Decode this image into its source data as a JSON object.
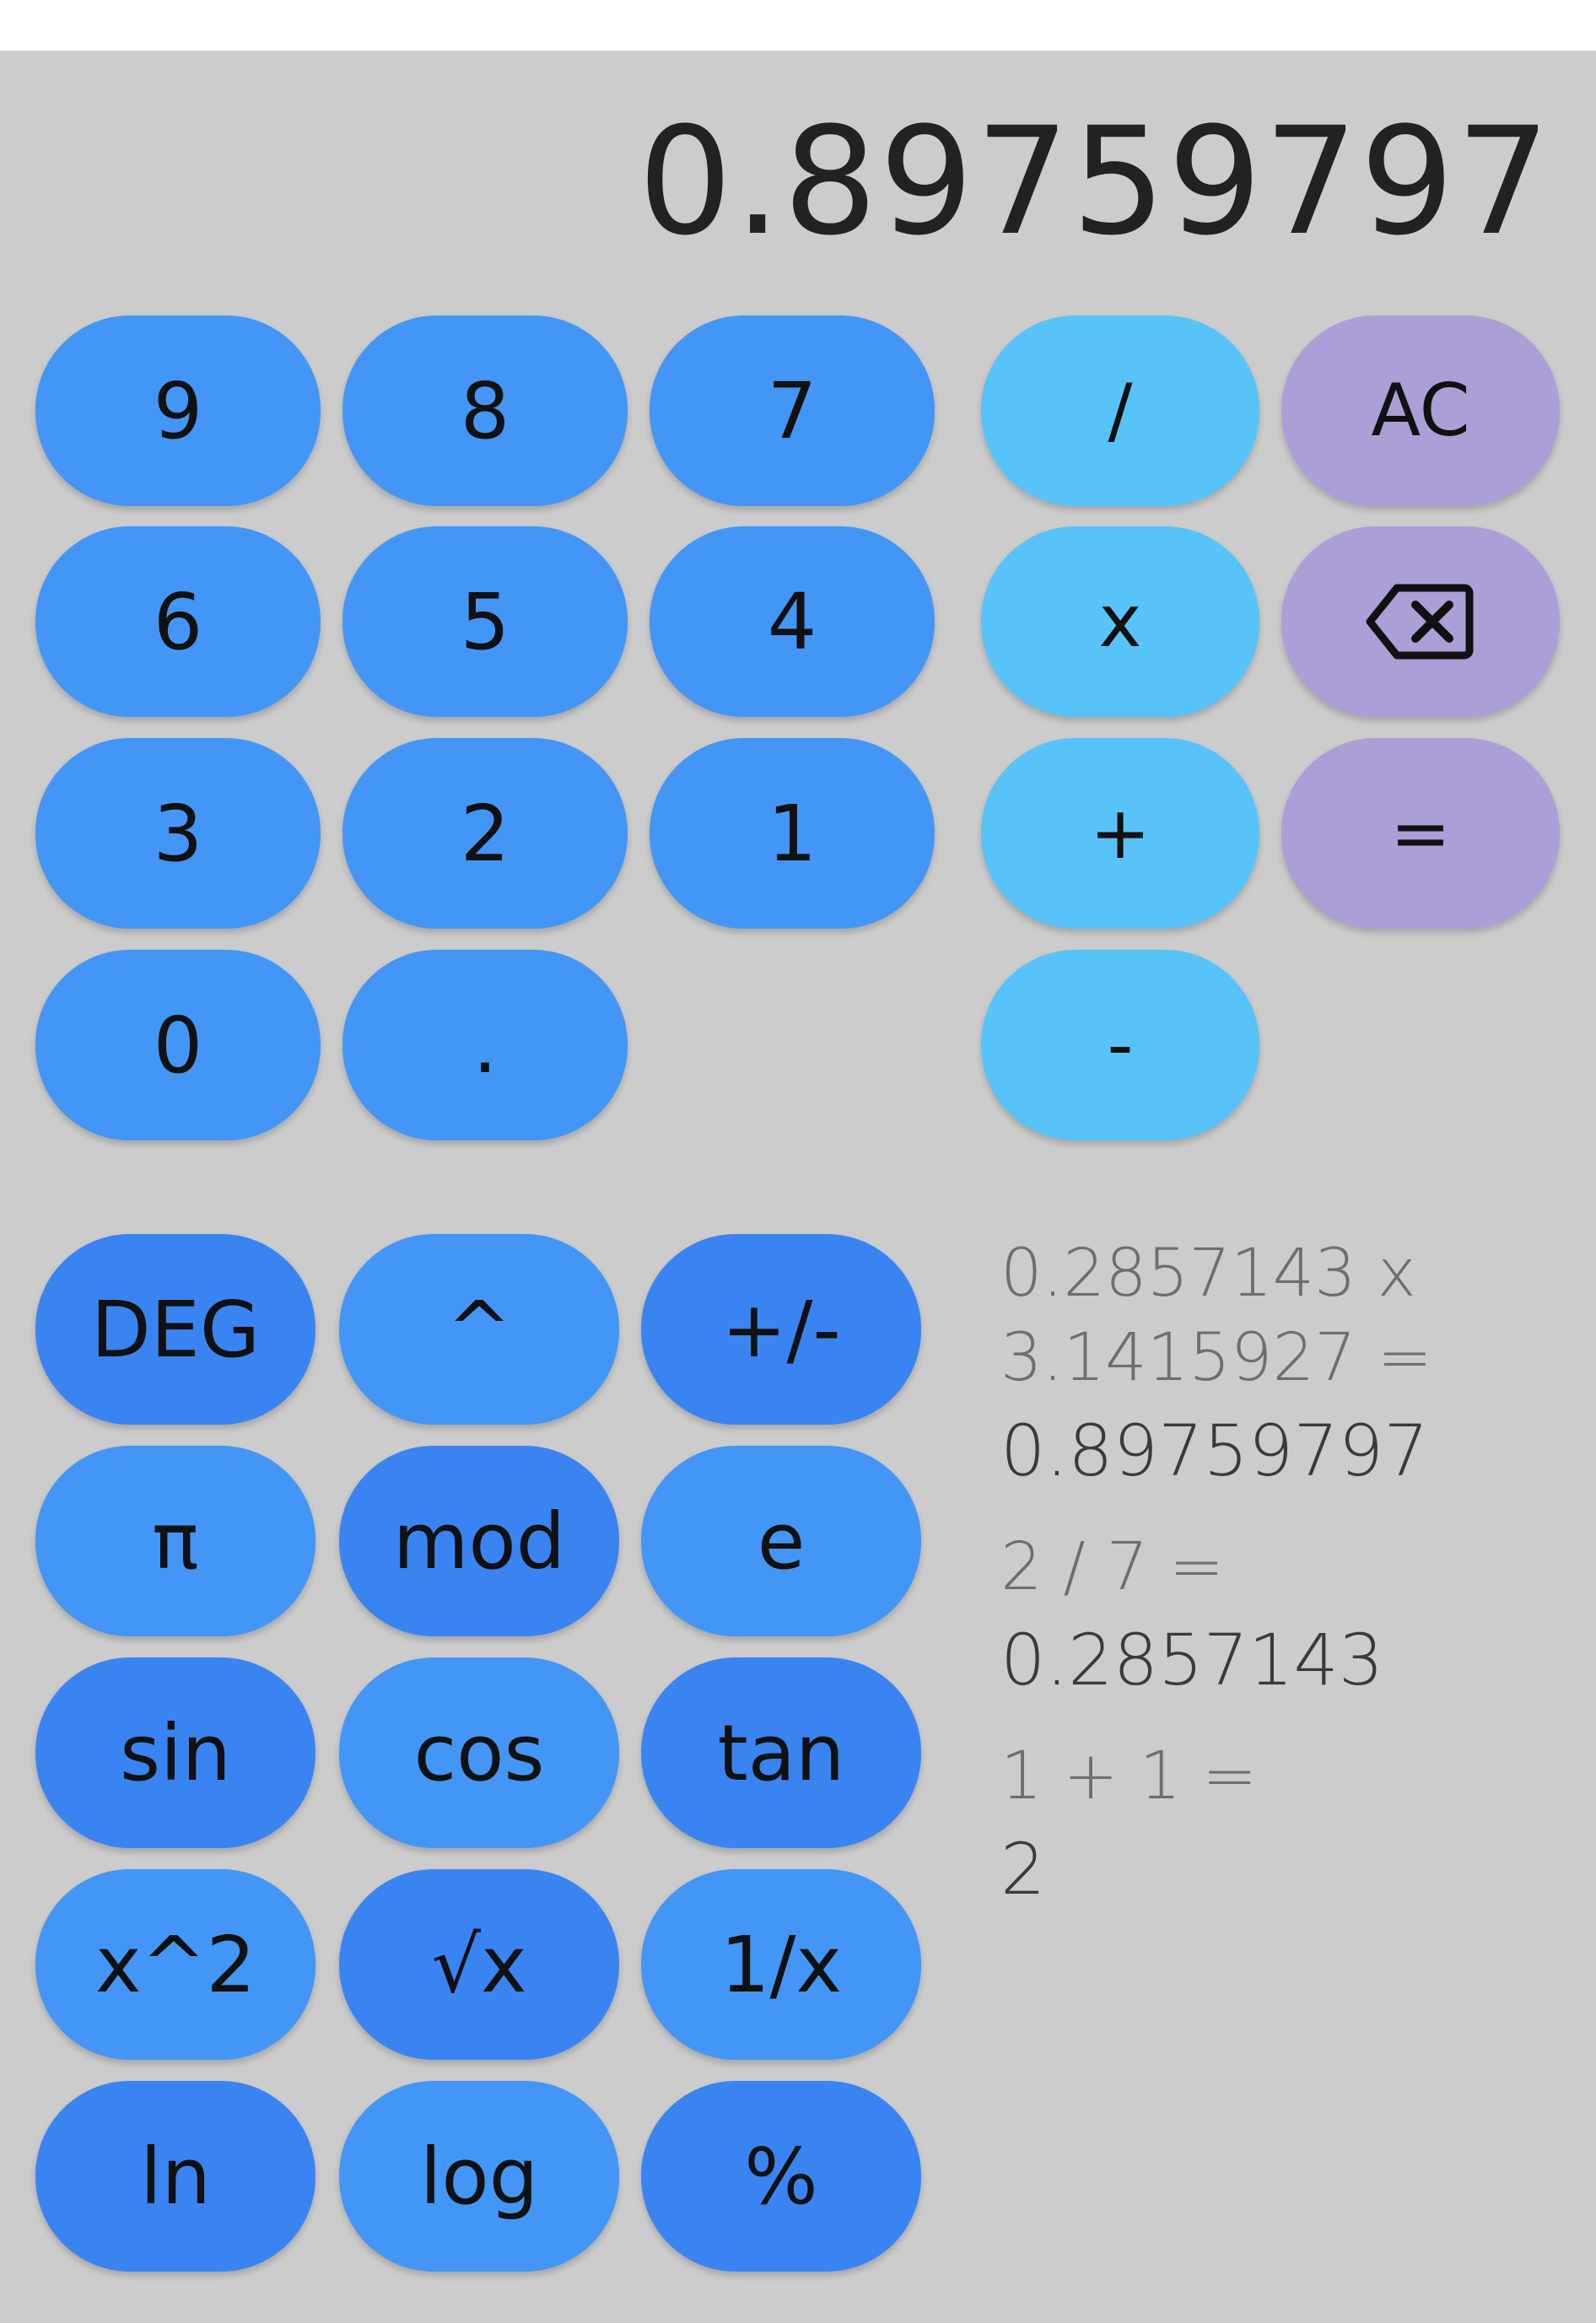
{
  "display": {
    "value": "0.89759797"
  },
  "keypad": {
    "digits": {
      "nine": "9",
      "eight": "8",
      "seven": "7",
      "six": "6",
      "five": "5",
      "four": "4",
      "three": "3",
      "two": "2",
      "one": "1",
      "zero": "0",
      "point": "."
    },
    "operators": {
      "divide": "/",
      "multiply": "x",
      "add": "+",
      "subtract": "-"
    },
    "controls": {
      "clear": "AC",
      "backspace_icon": "backspace-icon",
      "equals": "="
    }
  },
  "scientific": {
    "rows": [
      [
        "DEG",
        "^",
        "+/-"
      ],
      [
        "π",
        "mod",
        "e"
      ],
      [
        "sin",
        "cos",
        "tan"
      ],
      [
        "x^2",
        "√x",
        "1/x"
      ],
      [
        "ln",
        "log",
        "%"
      ]
    ]
  },
  "history": [
    {
      "expression": "0.2857143 x\n3.1415927 =",
      "result": "0.89759797"
    },
    {
      "expression": "2 / 7 =",
      "result": "0.2857143"
    },
    {
      "expression": "1 + 1 =",
      "result": "2"
    }
  ],
  "colors": {
    "background": "#cccccc",
    "digit_button": "#4396f6",
    "operator_button": "#58c3f9",
    "control_button": "#ac9fd8",
    "sci_light": "#4396f6",
    "sci_dark": "#3a84f2"
  }
}
